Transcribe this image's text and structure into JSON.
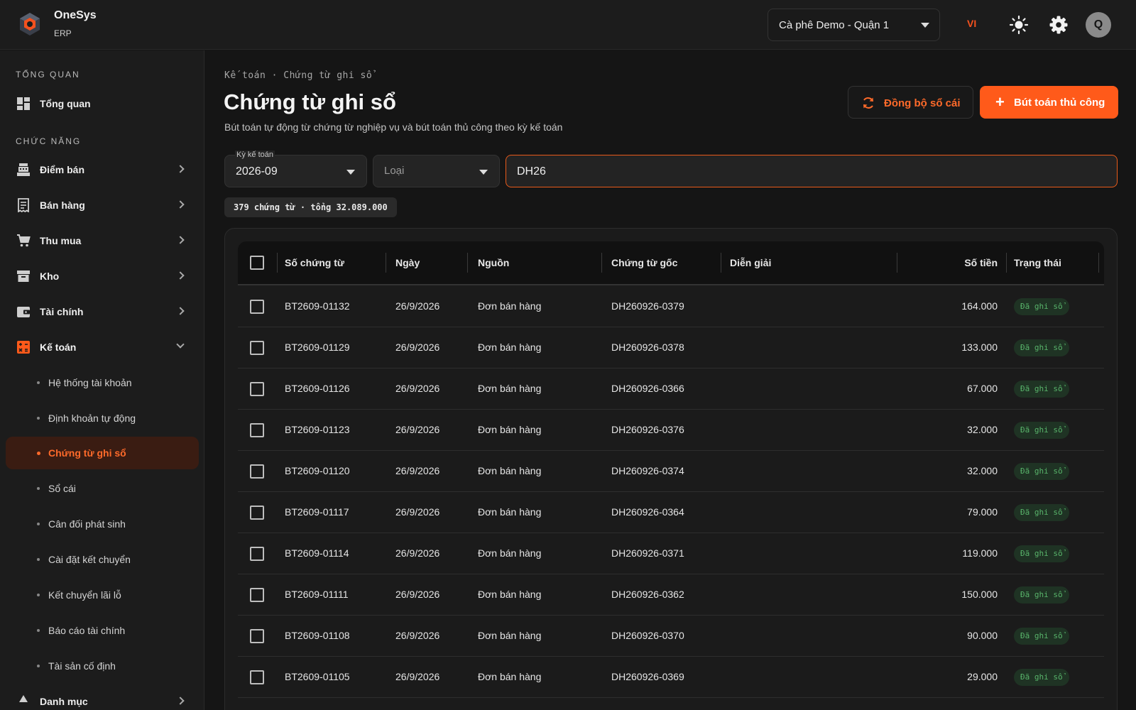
{
  "header": {
    "brand_name": "OneSys",
    "brand_sub": "ERP",
    "store": "Cà phê Demo - Quận 1",
    "lang": "VI",
    "avatar_letter": "Q"
  },
  "sidebar": {
    "section_overview": "TỔNG QUAN",
    "overview_item": "Tổng quan",
    "section_functions": "CHỨC NĂNG",
    "items": [
      {
        "label": "Điểm bán",
        "icon": "cash-register-icon"
      },
      {
        "label": "Bán hàng",
        "icon": "receipt-icon"
      },
      {
        "label": "Thu mua",
        "icon": "cart-icon"
      },
      {
        "label": "Kho",
        "icon": "archive-icon"
      },
      {
        "label": "Tài chính",
        "icon": "wallet-icon"
      },
      {
        "label": "Kế toán",
        "icon": "calculator-icon"
      }
    ],
    "sub_items": [
      "Hệ thống tài khoản",
      "Định khoản tự động",
      "Chứng từ ghi sổ",
      "Sổ cái",
      "Cân đối phát sinh",
      "Cài đặt kết chuyển",
      "Kết chuyển lãi lỗ",
      "Báo cáo tài chính",
      "Tài sản cố định"
    ],
    "next_item": "Danh mục"
  },
  "page": {
    "breadcrumb": "Kế toán · Chứng từ ghi sổ",
    "title": "Chứng từ ghi sổ",
    "subtitle": "Bút toán tự động từ chứng từ nghiệp vụ và bút toán thủ công theo kỳ kế toán",
    "sync_button": "Đồng bộ sổ cái",
    "manual_button": "Bút toán thủ công",
    "period_label": "Kỳ kế toán",
    "period_value": "2026-09",
    "type_placeholder": "Loại",
    "search_value": "DH26",
    "summary": "379 chứng từ · tổng 32.089.000"
  },
  "table": {
    "columns": [
      "Số chứng từ",
      "Ngày",
      "Nguồn",
      "Chứng từ gốc",
      "Diễn giải",
      "Số tiền",
      "Trạng thái"
    ],
    "rows": [
      {
        "no": "BT2609-01132",
        "date": "26/9/2026",
        "source": "Đơn bán hàng",
        "origin": "DH260926-0379",
        "desc": "",
        "amount": "164.000",
        "status": "Đã ghi sổ"
      },
      {
        "no": "BT2609-01129",
        "date": "26/9/2026",
        "source": "Đơn bán hàng",
        "origin": "DH260926-0378",
        "desc": "",
        "amount": "133.000",
        "status": "Đã ghi sổ"
      },
      {
        "no": "BT2609-01126",
        "date": "26/9/2026",
        "source": "Đơn bán hàng",
        "origin": "DH260926-0366",
        "desc": "",
        "amount": "67.000",
        "status": "Đã ghi sổ"
      },
      {
        "no": "BT2609-01123",
        "date": "26/9/2026",
        "source": "Đơn bán hàng",
        "origin": "DH260926-0376",
        "desc": "",
        "amount": "32.000",
        "status": "Đã ghi sổ"
      },
      {
        "no": "BT2609-01120",
        "date": "26/9/2026",
        "source": "Đơn bán hàng",
        "origin": "DH260926-0374",
        "desc": "",
        "amount": "32.000",
        "status": "Đã ghi sổ"
      },
      {
        "no": "BT2609-01117",
        "date": "26/9/2026",
        "source": "Đơn bán hàng",
        "origin": "DH260926-0364",
        "desc": "",
        "amount": "79.000",
        "status": "Đã ghi sổ"
      },
      {
        "no": "BT2609-01114",
        "date": "26/9/2026",
        "source": "Đơn bán hàng",
        "origin": "DH260926-0371",
        "desc": "",
        "amount": "119.000",
        "status": "Đã ghi sổ"
      },
      {
        "no": "BT2609-01111",
        "date": "26/9/2026",
        "source": "Đơn bán hàng",
        "origin": "DH260926-0362",
        "desc": "",
        "amount": "150.000",
        "status": "Đã ghi sổ"
      },
      {
        "no": "BT2609-01108",
        "date": "26/9/2026",
        "source": "Đơn bán hàng",
        "origin": "DH260926-0370",
        "desc": "",
        "amount": "90.000",
        "status": "Đã ghi sổ"
      },
      {
        "no": "BT2609-01105",
        "date": "26/9/2026",
        "source": "Đơn bán hàng",
        "origin": "DH260926-0369",
        "desc": "",
        "amount": "29.000",
        "status": "Đã ghi sổ"
      }
    ]
  },
  "colors": {
    "accent": "#ff5a1a",
    "success": "#58b36a"
  }
}
